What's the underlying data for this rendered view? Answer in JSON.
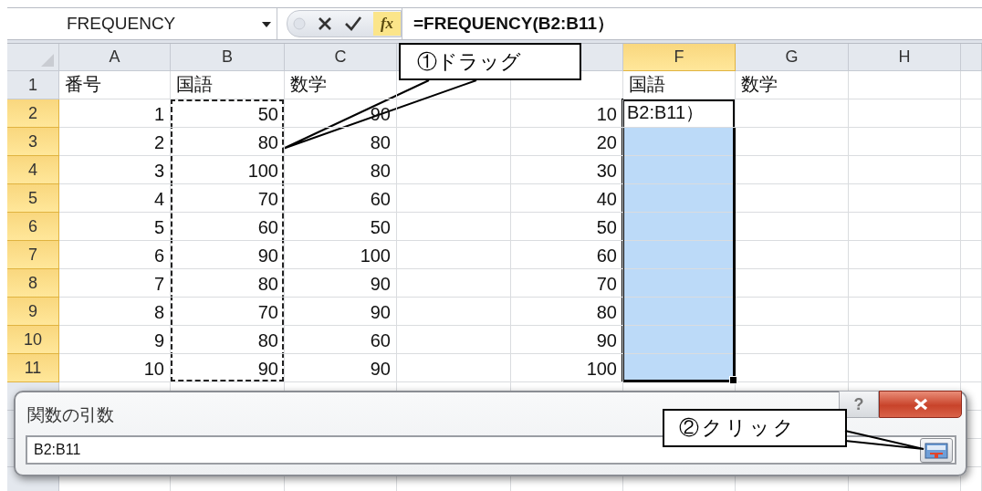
{
  "formula_bar": {
    "name_box": "FREQUENCY",
    "function_button": "fx",
    "formula": "=FREQUENCY(B2:B11）"
  },
  "columns": [
    {
      "label": "A",
      "selected": false
    },
    {
      "label": "B",
      "selected": false,
      "marquee": true
    },
    {
      "label": "C",
      "selected": false
    },
    {
      "selected": false
    },
    {
      "selected": false
    },
    {
      "label": "F",
      "selected": true
    },
    {
      "label": "G",
      "selected": false
    },
    {
      "label": "H",
      "selected": false
    }
  ],
  "rows": [
    {
      "label": "1",
      "selected": false,
      "kind": "text",
      "cells": [
        "番号",
        "国語",
        "数学",
        null,
        null,
        "国語",
        "数学",
        null
      ]
    },
    {
      "label": "2",
      "selected": true,
      "kind": "number",
      "cells": [
        "1",
        "50",
        "90",
        null,
        "10",
        "B2:B11）",
        null,
        null
      ]
    },
    {
      "label": "3",
      "selected": true,
      "kind": "number",
      "cells": [
        "2",
        "80",
        "80",
        null,
        "20",
        null,
        null,
        null
      ]
    },
    {
      "label": "4",
      "selected": true,
      "kind": "number",
      "cells": [
        "3",
        "100",
        "80",
        null,
        "30",
        null,
        null,
        null
      ]
    },
    {
      "label": "5",
      "selected": true,
      "kind": "number",
      "cells": [
        "4",
        "70",
        "60",
        null,
        "40",
        null,
        null,
        null
      ]
    },
    {
      "label": "6",
      "selected": true,
      "kind": "number",
      "cells": [
        "5",
        "60",
        "50",
        null,
        "50",
        null,
        null,
        null
      ]
    },
    {
      "label": "7",
      "selected": true,
      "kind": "number",
      "cells": [
        "6",
        "90",
        "100",
        null,
        "60",
        null,
        null,
        null
      ]
    },
    {
      "label": "8",
      "selected": true,
      "kind": "number",
      "cells": [
        "7",
        "80",
        "90",
        null,
        "70",
        null,
        null,
        null
      ]
    },
    {
      "label": "9",
      "selected": true,
      "kind": "number",
      "cells": [
        "8",
        "70",
        "90",
        null,
        "80",
        null,
        null,
        null
      ]
    },
    {
      "label": "10",
      "selected": true,
      "kind": "number",
      "cells": [
        "9",
        "80",
        "60",
        null,
        "90",
        null,
        null,
        null
      ]
    },
    {
      "label": "11",
      "selected": true,
      "kind": "number",
      "cells": [
        "10",
        "90",
        "90",
        null,
        "100",
        null,
        null,
        null
      ]
    }
  ],
  "dialog": {
    "title": "関数の引数",
    "help_button": "?",
    "value": "B2:B11"
  },
  "callouts": [
    {
      "text": "①ドラッグ"
    },
    {
      "text": "②クリック"
    }
  ]
}
